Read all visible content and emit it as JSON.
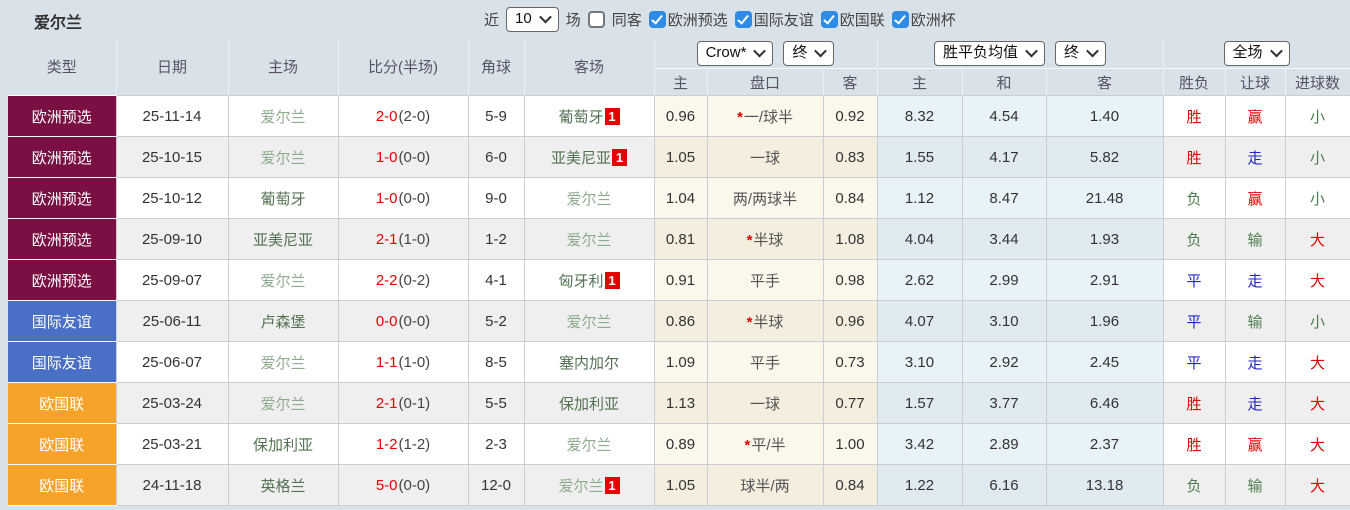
{
  "palette": {
    "accent_checkbox": "#2E8BE6",
    "red": "#E60000",
    "blue": "#2222CC",
    "green": "#4E7E4E",
    "team_self": "#90AC90",
    "team_opponent": "#547254",
    "badge_red": "#E60000",
    "score_halftime": "#444444"
  },
  "type_colors": {
    "欧洲预选": "#7A0F44",
    "国际友谊": "#4A6FC6",
    "欧国联": "#F7A329"
  },
  "topbar": {
    "title": "爱尔兰",
    "recent_label": "近",
    "count_select": "10",
    "matches_label": "场",
    "same_venue_label": "同客",
    "same_venue_checked": false,
    "filters": [
      {
        "label": "欧洲预选",
        "checked": true
      },
      {
        "label": "国际友谊",
        "checked": true
      },
      {
        "label": "欧国联",
        "checked": true
      },
      {
        "label": "欧洲杯",
        "checked": true
      }
    ]
  },
  "table": {
    "columns": {
      "type": "类型",
      "date": "日期",
      "home": "主场",
      "score": "比分(半场)",
      "corner": "角球",
      "away": "客场",
      "odds_home": "主",
      "odds_handicap": "盘口",
      "odds_away": "客",
      "avg_home": "主",
      "avg_draw": "和",
      "avg_away": "客",
      "result": "胜负",
      "handicap_result": "让球",
      "goals": "进球数"
    },
    "selects": {
      "bookmaker": "Crow*",
      "bookmaker_state": "终",
      "wdl": "胜平负均值",
      "wdl_state": "终",
      "period": "全场"
    }
  },
  "rows": [
    {
      "type": "欧洲预选",
      "date": "25-11-14",
      "home": {
        "name": "爱尔兰",
        "self": true
      },
      "score_ft": "2-0",
      "score_ht": "(2-0)",
      "corner": "5-9",
      "away": {
        "name": "葡萄牙",
        "self": false,
        "badge": "1"
      },
      "crown_home": "0.96",
      "handicap_star": true,
      "handicap": "一/球半",
      "crown_away": "0.92",
      "avg_home": "8.32",
      "avg_draw": "4.54",
      "avg_away": "1.40",
      "result": {
        "text": "胜",
        "color": "red"
      },
      "handicap_result": {
        "text": "赢",
        "color": "red"
      },
      "goals": {
        "text": "小",
        "color": "green"
      }
    },
    {
      "type": "欧洲预选",
      "date": "25-10-15",
      "home": {
        "name": "爱尔兰",
        "self": true
      },
      "score_ft": "1-0",
      "score_ht": "(0-0)",
      "corner": "6-0",
      "away": {
        "name": "亚美尼亚",
        "self": false,
        "badge": "1"
      },
      "crown_home": "1.05",
      "handicap_star": false,
      "handicap": "一球",
      "crown_away": "0.83",
      "avg_home": "1.55",
      "avg_draw": "4.17",
      "avg_away": "5.82",
      "result": {
        "text": "胜",
        "color": "red"
      },
      "handicap_result": {
        "text": "走",
        "color": "blue"
      },
      "goals": {
        "text": "小",
        "color": "green"
      }
    },
    {
      "type": "欧洲预选",
      "date": "25-10-12",
      "home": {
        "name": "葡萄牙",
        "self": false
      },
      "score_ft": "1-0",
      "score_ht": "(0-0)",
      "corner": "9-0",
      "away": {
        "name": "爱尔兰",
        "self": true
      },
      "crown_home": "1.04",
      "handicap_star": false,
      "handicap": "两/两球半",
      "crown_away": "0.84",
      "avg_home": "1.12",
      "avg_draw": "8.47",
      "avg_away": "21.48",
      "result": {
        "text": "负",
        "color": "green"
      },
      "handicap_result": {
        "text": "赢",
        "color": "red"
      },
      "goals": {
        "text": "小",
        "color": "green"
      }
    },
    {
      "type": "欧洲预选",
      "date": "25-09-10",
      "home": {
        "name": "亚美尼亚",
        "self": false
      },
      "score_ft": "2-1",
      "score_ht": "(1-0)",
      "corner": "1-2",
      "away": {
        "name": "爱尔兰",
        "self": true
      },
      "crown_home": "0.81",
      "handicap_star": true,
      "handicap": "半球",
      "crown_away": "1.08",
      "avg_home": "4.04",
      "avg_draw": "3.44",
      "avg_away": "1.93",
      "result": {
        "text": "负",
        "color": "green"
      },
      "handicap_result": {
        "text": "输",
        "color": "green"
      },
      "goals": {
        "text": "大",
        "color": "red"
      }
    },
    {
      "type": "欧洲预选",
      "date": "25-09-07",
      "home": {
        "name": "爱尔兰",
        "self": true
      },
      "score_ft": "2-2",
      "score_ht": "(0-2)",
      "corner": "4-1",
      "away": {
        "name": "匈牙利",
        "self": false,
        "badge": "1"
      },
      "crown_home": "0.91",
      "handicap_star": false,
      "handicap": "平手",
      "crown_away": "0.98",
      "avg_home": "2.62",
      "avg_draw": "2.99",
      "avg_away": "2.91",
      "result": {
        "text": "平",
        "color": "blue"
      },
      "handicap_result": {
        "text": "走",
        "color": "blue"
      },
      "goals": {
        "text": "大",
        "color": "red"
      }
    },
    {
      "type": "国际友谊",
      "date": "25-06-11",
      "home": {
        "name": "卢森堡",
        "self": false
      },
      "score_ft": "0-0",
      "score_ht": "(0-0)",
      "corner": "5-2",
      "away": {
        "name": "爱尔兰",
        "self": true
      },
      "crown_home": "0.86",
      "handicap_star": true,
      "handicap": "半球",
      "crown_away": "0.96",
      "avg_home": "4.07",
      "avg_draw": "3.10",
      "avg_away": "1.96",
      "result": {
        "text": "平",
        "color": "blue"
      },
      "handicap_result": {
        "text": "输",
        "color": "green"
      },
      "goals": {
        "text": "小",
        "color": "green"
      }
    },
    {
      "type": "国际友谊",
      "date": "25-06-07",
      "home": {
        "name": "爱尔兰",
        "self": true
      },
      "score_ft": "1-1",
      "score_ht": "(1-0)",
      "corner": "8-5",
      "away": {
        "name": "塞内加尔",
        "self": false
      },
      "crown_home": "1.09",
      "handicap_star": false,
      "handicap": "平手",
      "crown_away": "0.73",
      "avg_home": "3.10",
      "avg_draw": "2.92",
      "avg_away": "2.45",
      "result": {
        "text": "平",
        "color": "blue"
      },
      "handicap_result": {
        "text": "走",
        "color": "blue"
      },
      "goals": {
        "text": "大",
        "color": "red"
      }
    },
    {
      "type": "欧国联",
      "date": "25-03-24",
      "home": {
        "name": "爱尔兰",
        "self": true
      },
      "score_ft": "2-1",
      "score_ht": "(0-1)",
      "corner": "5-5",
      "away": {
        "name": "保加利亚",
        "self": false
      },
      "crown_home": "1.13",
      "handicap_star": false,
      "handicap": "一球",
      "crown_away": "0.77",
      "avg_home": "1.57",
      "avg_draw": "3.77",
      "avg_away": "6.46",
      "result": {
        "text": "胜",
        "color": "red"
      },
      "handicap_result": {
        "text": "走",
        "color": "blue"
      },
      "goals": {
        "text": "大",
        "color": "red"
      }
    },
    {
      "type": "欧国联",
      "date": "25-03-21",
      "home": {
        "name": "保加利亚",
        "self": false
      },
      "score_ft": "1-2",
      "score_ht": "(1-2)",
      "corner": "2-3",
      "away": {
        "name": "爱尔兰",
        "self": true
      },
      "crown_home": "0.89",
      "handicap_star": true,
      "handicap": "平/半",
      "crown_away": "1.00",
      "avg_home": "3.42",
      "avg_draw": "2.89",
      "avg_away": "2.37",
      "result": {
        "text": "胜",
        "color": "red"
      },
      "handicap_result": {
        "text": "赢",
        "color": "red"
      },
      "goals": {
        "text": "大",
        "color": "red"
      }
    },
    {
      "type": "欧国联",
      "date": "24-11-18",
      "home": {
        "name": "英格兰",
        "self": false
      },
      "score_ft": "5-0",
      "score_ht": "(0-0)",
      "corner": "12-0",
      "away": {
        "name": "爱尔兰",
        "self": true,
        "badge": "1"
      },
      "crown_home": "1.05",
      "handicap_star": false,
      "handicap": "球半/两",
      "crown_away": "0.84",
      "avg_home": "1.22",
      "avg_draw": "6.16",
      "avg_away": "13.18",
      "result": {
        "text": "负",
        "color": "green"
      },
      "handicap_result": {
        "text": "输",
        "color": "green"
      },
      "goals": {
        "text": "大",
        "color": "red"
      }
    }
  ]
}
